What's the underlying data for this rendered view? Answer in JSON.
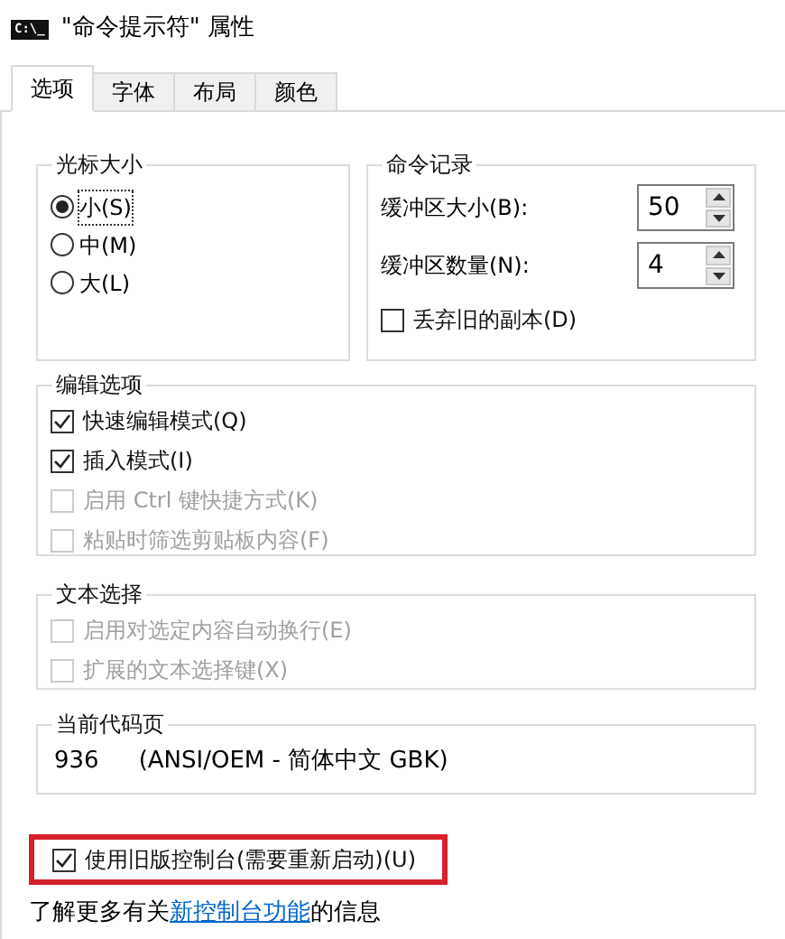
{
  "window": {
    "title": "\"命令提示符\" 属性",
    "icon_text": "C:\\_"
  },
  "tabs": [
    {
      "label": "选项",
      "selected": true
    },
    {
      "label": "字体",
      "selected": false
    },
    {
      "label": "布局",
      "selected": false
    },
    {
      "label": "颜色",
      "selected": false
    }
  ],
  "cursor_size": {
    "title": "光标大小",
    "options": [
      {
        "label": "小(S)",
        "selected": true
      },
      {
        "label": "中(M)",
        "selected": false
      },
      {
        "label": "大(L)",
        "selected": false
      }
    ]
  },
  "command_history": {
    "title": "命令记录",
    "fields": [
      {
        "label": "缓冲区大小(B):",
        "value": "50"
      },
      {
        "label": "缓冲区数量(N):",
        "value": "4"
      }
    ],
    "discard": {
      "label": "丢弃旧的副本(D)",
      "checked": false,
      "disabled": false
    }
  },
  "edit_options": {
    "title": "编辑选项",
    "items": [
      {
        "label": "快速编辑模式(Q)",
        "checked": true,
        "disabled": false
      },
      {
        "label": "插入模式(I)",
        "checked": true,
        "disabled": false
      },
      {
        "label": "启用 Ctrl 键快捷方式(K)",
        "checked": false,
        "disabled": true
      },
      {
        "label": "粘贴时筛选剪贴板内容(F)",
        "checked": false,
        "disabled": true
      }
    ]
  },
  "text_selection": {
    "title": "文本选择",
    "items": [
      {
        "label": "启用对选定内容自动换行(E)",
        "checked": false,
        "disabled": true
      },
      {
        "label": "扩展的文本选择键(X)",
        "checked": false,
        "disabled": true
      }
    ]
  },
  "code_page": {
    "title": "当前代码页",
    "number": "936",
    "name": "(ANSI/OEM - 简体中文 GBK)"
  },
  "legacy_console": {
    "label": "使用旧版控制台(需要重新启动)(U)",
    "checked": true,
    "disabled": false,
    "highlighted": true
  },
  "info": {
    "prefix": "了解更多有关",
    "link": "新控制台功能",
    "suffix": "的信息"
  }
}
